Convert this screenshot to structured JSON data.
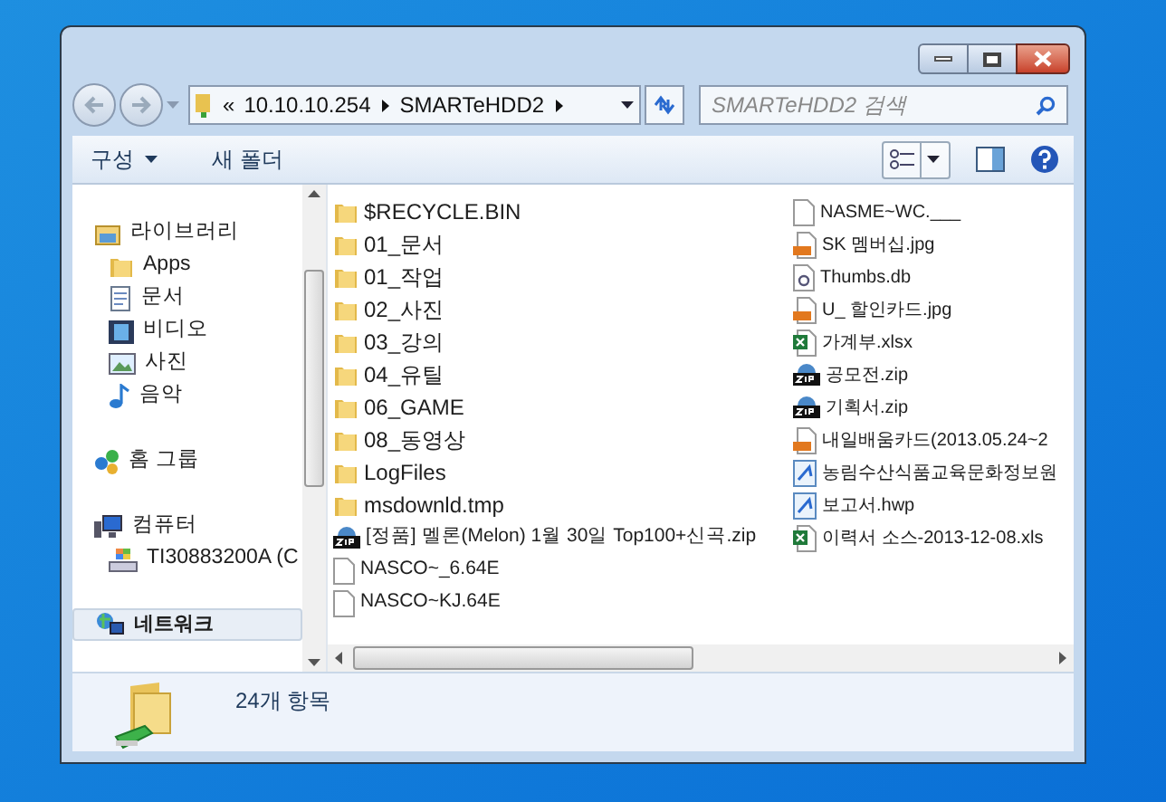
{
  "address": {
    "overflow": "«",
    "crumbs": [
      "10.10.10.254",
      "SMARTeHDD2"
    ]
  },
  "search": {
    "placeholder": "SMARTeHDD2 검색"
  },
  "toolbar": [
    {
      "label": "구성",
      "dropdown": true
    },
    {
      "label": "새 폴더",
      "dropdown": false
    }
  ],
  "nav": [
    {
      "label": "라이브러리",
      "kind": "library",
      "selected": false,
      "children": [
        {
          "label": "Apps",
          "kind": "folder",
          "selected": false
        },
        {
          "label": "문서",
          "kind": "document",
          "selected": false
        },
        {
          "label": "비디오",
          "kind": "video",
          "selected": false
        },
        {
          "label": "사진",
          "kind": "picture",
          "selected": false
        },
        {
          "label": "음악",
          "kind": "music",
          "selected": false
        }
      ]
    },
    {
      "label": "홈 그룹",
      "kind": "homegroup",
      "selected": false
    },
    {
      "label": "컴퓨터",
      "kind": "computer",
      "selected": false,
      "children": [
        {
          "label": "TI30883200A (C",
          "kind": "drive",
          "selected": false
        }
      ]
    },
    {
      "label": "네트워크",
      "kind": "network",
      "selected": true
    }
  ],
  "files": [
    {
      "name": "$RECYCLE.BIN",
      "kind": "folder"
    },
    {
      "name": "01_문서",
      "kind": "folder"
    },
    {
      "name": "01_작업",
      "kind": "folder"
    },
    {
      "name": "02_사진",
      "kind": "folder"
    },
    {
      "name": "03_강의",
      "kind": "folder"
    },
    {
      "name": "04_유틸",
      "kind": "folder"
    },
    {
      "name": "06_GAME",
      "kind": "folder"
    },
    {
      "name": "08_동영상",
      "kind": "folder"
    },
    {
      "name": "LogFiles",
      "kind": "folder"
    },
    {
      "name": "msdownld.tmp",
      "kind": "folder"
    },
    {
      "name": "[정품] 멜론(Melon) 1월 30일 Top100+신곡.zip",
      "kind": "zip"
    },
    {
      "name": "NASCO~_6.64E",
      "kind": "file"
    },
    {
      "name": "NASCO~KJ.64E",
      "kind": "file"
    },
    {
      "name": "NASME~WC.___",
      "kind": "file"
    },
    {
      "name": "SK 멤버십.jpg",
      "kind": "jpg"
    },
    {
      "name": "Thumbs.db",
      "kind": "db"
    },
    {
      "name": "U_ 할인카드.jpg",
      "kind": "jpg"
    },
    {
      "name": "가계부.xlsx",
      "kind": "xlsx"
    },
    {
      "name": "공모전.zip",
      "kind": "zip"
    },
    {
      "name": "기획서.zip",
      "kind": "zip"
    },
    {
      "name": "내일배움카드(2013.05.24~2",
      "kind": "jpg"
    },
    {
      "name": "농림수산식품교육문화정보원",
      "kind": "hwp"
    },
    {
      "name": "보고서.hwp",
      "kind": "hwp"
    },
    {
      "name": "이력서 소스-2013-12-08.xls",
      "kind": "xlsx"
    }
  ],
  "status": {
    "count": "24개 항목"
  }
}
